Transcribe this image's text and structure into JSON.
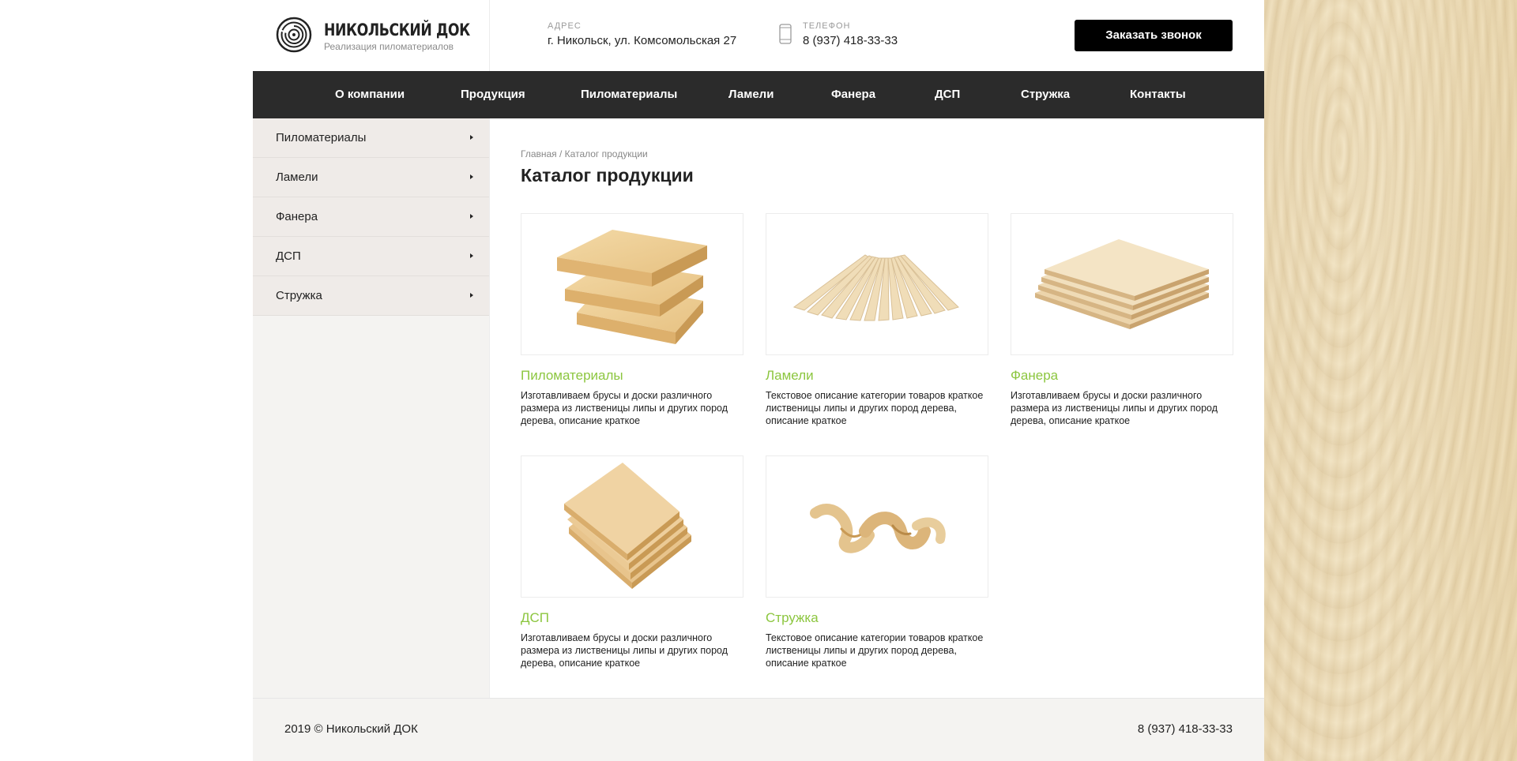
{
  "header": {
    "logo_title": "НИКОЛЬСКИЙ ДОК",
    "logo_subtitle": "Реализация пиломатериалов",
    "address_label": "АДРЕС",
    "address_value": "г. Никольск, ул. Комсомольская 27",
    "phone_label": "ТЕЛЕФОН",
    "phone_value": "8 (937) 418-33-33",
    "call_button": "Заказать звонок"
  },
  "nav": {
    "items": [
      {
        "label": "О компании"
      },
      {
        "label": "Продукция"
      },
      {
        "label": "Пиломатериалы"
      },
      {
        "label": "Ламели"
      },
      {
        "label": "Фанера"
      },
      {
        "label": "ДСП"
      },
      {
        "label": "Стружка"
      },
      {
        "label": "Контакты"
      }
    ]
  },
  "sidebar": {
    "items": [
      {
        "label": "Пиломатериалы"
      },
      {
        "label": "Ламели"
      },
      {
        "label": "Фанера"
      },
      {
        "label": "ДСП"
      },
      {
        "label": "Стружка"
      }
    ]
  },
  "main": {
    "breadcrumb": "Главная / Каталог продукции",
    "title": "Каталог продукции",
    "cards": [
      {
        "title": "Пиломатериалы",
        "desc": "Изготавливаем брусы и доски различного размера из лиственицы липы и других пород дерева, описание краткое",
        "icon": "lumber-image"
      },
      {
        "title": "Ламели",
        "desc": "Текстовое описание категории товаров краткое лиственицы липы и других пород дерева, описание краткое",
        "icon": "lamellas-image"
      },
      {
        "title": "Фанера",
        "desc": "Изготавливаем брусы и доски различного размера из лиственицы липы и других пород дерева, описание краткое",
        "icon": "plywood-image"
      },
      {
        "title": "ДСП",
        "desc": "Изготавливаем брусы и доски различного размера из лиственицы липы и других пород дерева, описание краткое",
        "icon": "chipboard-image"
      },
      {
        "title": "Стружка",
        "desc": "Текстовое описание категории товаров краткое лиственицы липы и других пород дерева, описание краткое",
        "icon": "shavings-image"
      }
    ]
  },
  "footer": {
    "copyright": "2019 © Никольский ДОК",
    "phone": "8 (937) 418-33-33"
  },
  "colors": {
    "accent_green": "#8cc63f",
    "nav_bg": "#2b2b2b",
    "button_bg": "#000000",
    "sidebar_bg": "#f4f3f1"
  }
}
